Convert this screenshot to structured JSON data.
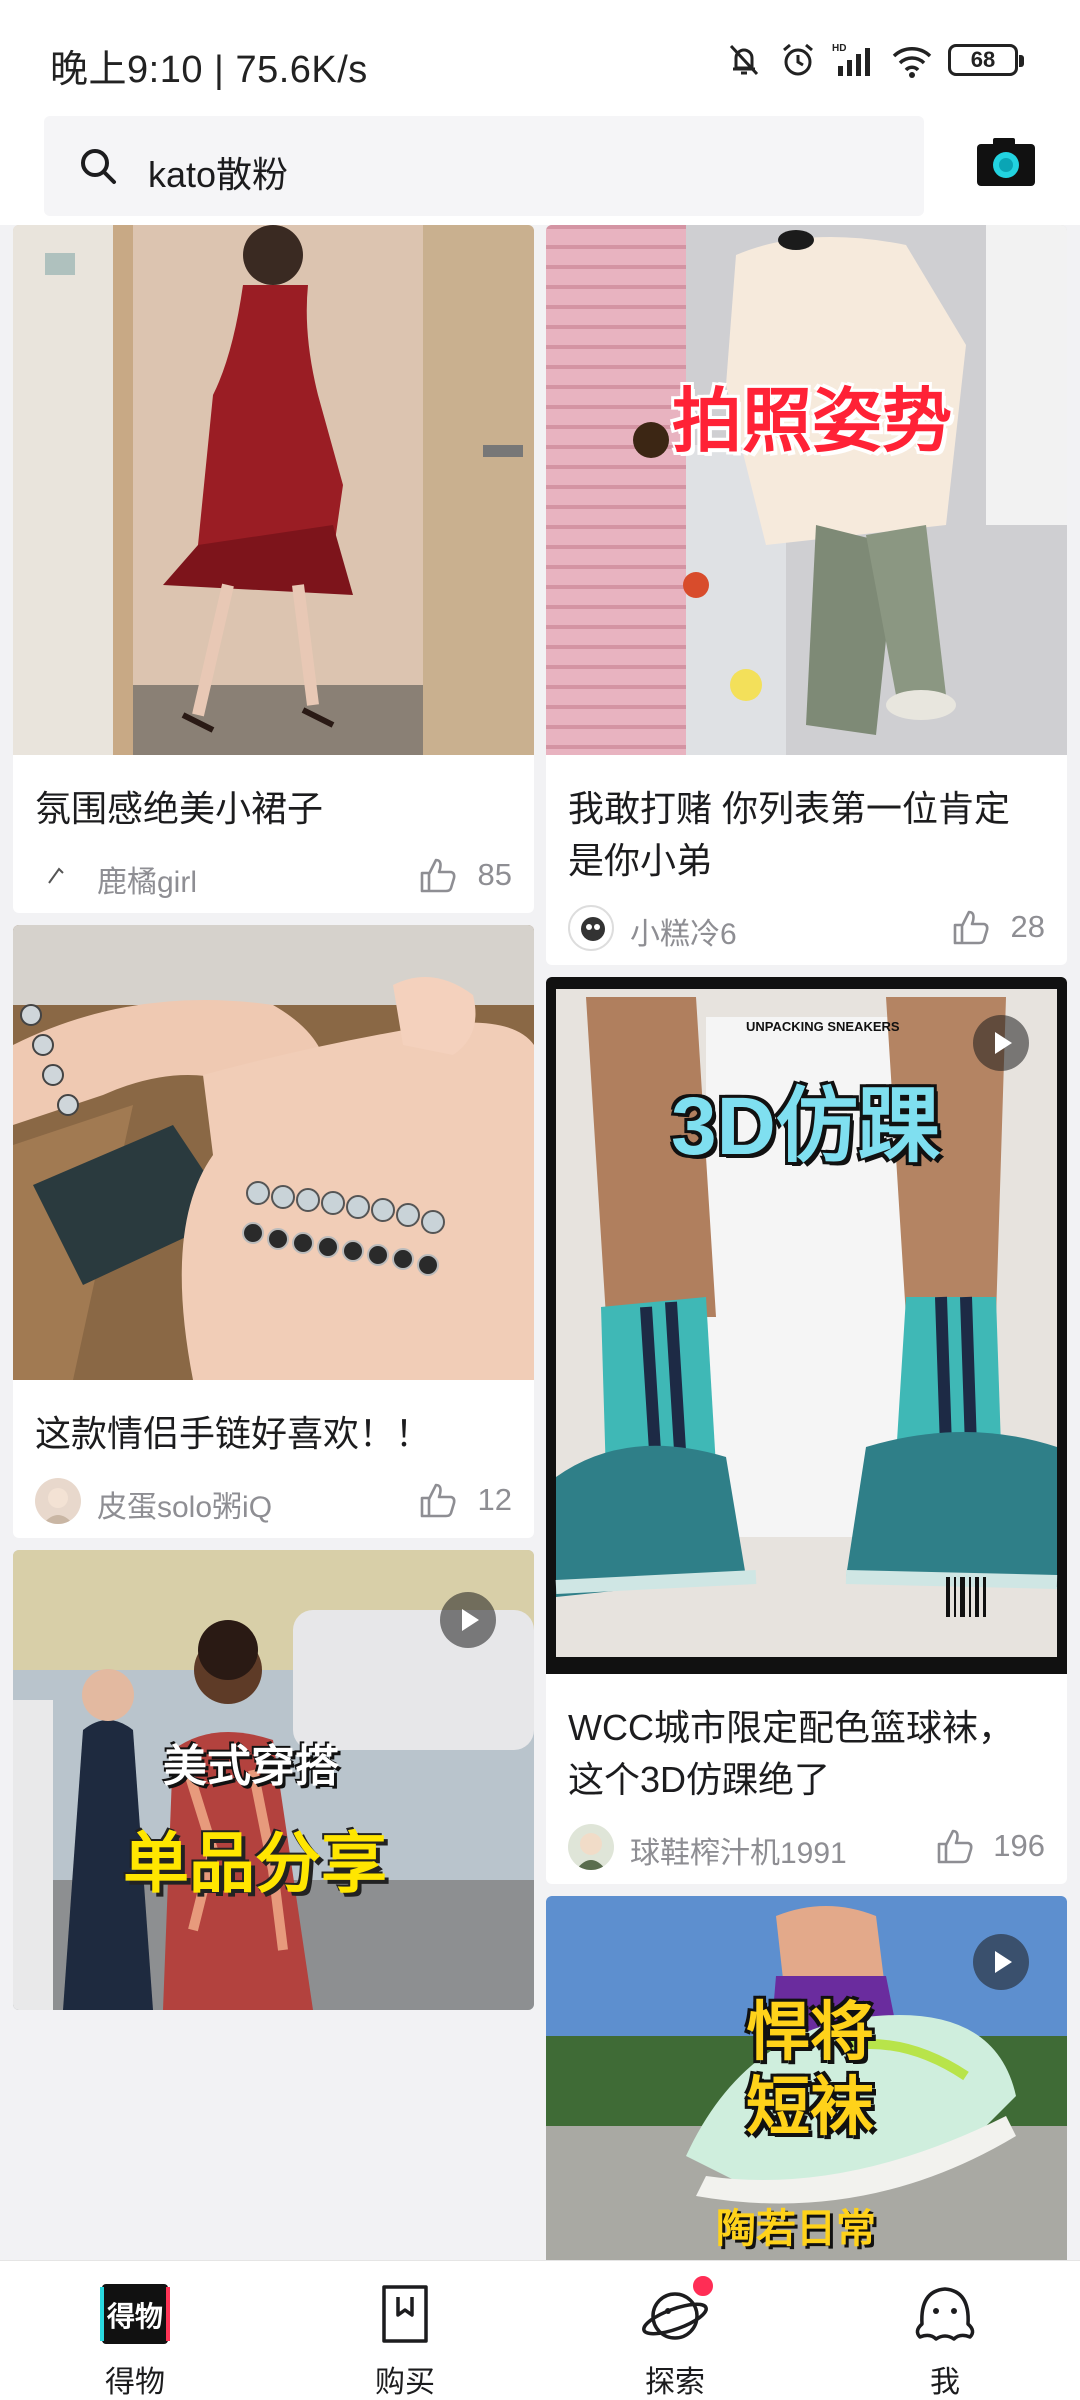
{
  "status_bar": {
    "time_speed": "晚上9:10 | 75.6K/s",
    "battery": "68",
    "network": "HD"
  },
  "search": {
    "query": "kato散粉",
    "icon": "search-icon",
    "camera_icon": "camera-icon"
  },
  "feed": {
    "left_column": [
      {
        "title": "氛围感绝美小裙子",
        "author": "鹿橘girl",
        "likes": "85",
        "image": "red-ruffle-dress-photo",
        "video": false
      },
      {
        "title": "这款情侣手链好喜欢！！",
        "author": "皮蛋solo粥iQ",
        "likes": "12",
        "image": "couple-bracelets-photo",
        "video": false
      },
      {
        "overlay_line1": "美式穿搭",
        "overlay_line2": "单品分享",
        "image": "streetwear-outfit-photo",
        "video": true
      }
    ],
    "right_column": [
      {
        "overlay": "拍照姿势",
        "title": "我敢打赌 你列表第一位肯定是你小弟",
        "author": "小糕冷6",
        "likes": "28",
        "image": "hoodie-pose-photo",
        "video": false
      },
      {
        "overlay_small": "UNPACKING SNEAKERS",
        "overlay": "3D仿踝",
        "title": "WCC城市限定配色篮球袜，这个3D仿踝绝了",
        "author": "球鞋榨汁机1991",
        "likes": "196",
        "image": "teal-socks-sneakers-photo",
        "video": true
      },
      {
        "overlay_line1": "悍将",
        "overlay_line2": "短袜",
        "overlay_bottom": "陶若日常",
        "image": "running-shoe-socks-photo",
        "video": true
      }
    ]
  },
  "bottom_nav": [
    {
      "label": "得物",
      "icon": "dewu-logo-icon"
    },
    {
      "label": "购买",
      "icon": "shopping-bag-icon"
    },
    {
      "label": "探索",
      "icon": "planet-icon",
      "badge": true
    },
    {
      "label": "我",
      "icon": "profile-mascot-icon"
    }
  ],
  "colors": {
    "background": "#f2f2f4",
    "accent_red": "#ff2d55",
    "camera_teal": "#22d3e0",
    "text_secondary": "#8e8e93"
  }
}
